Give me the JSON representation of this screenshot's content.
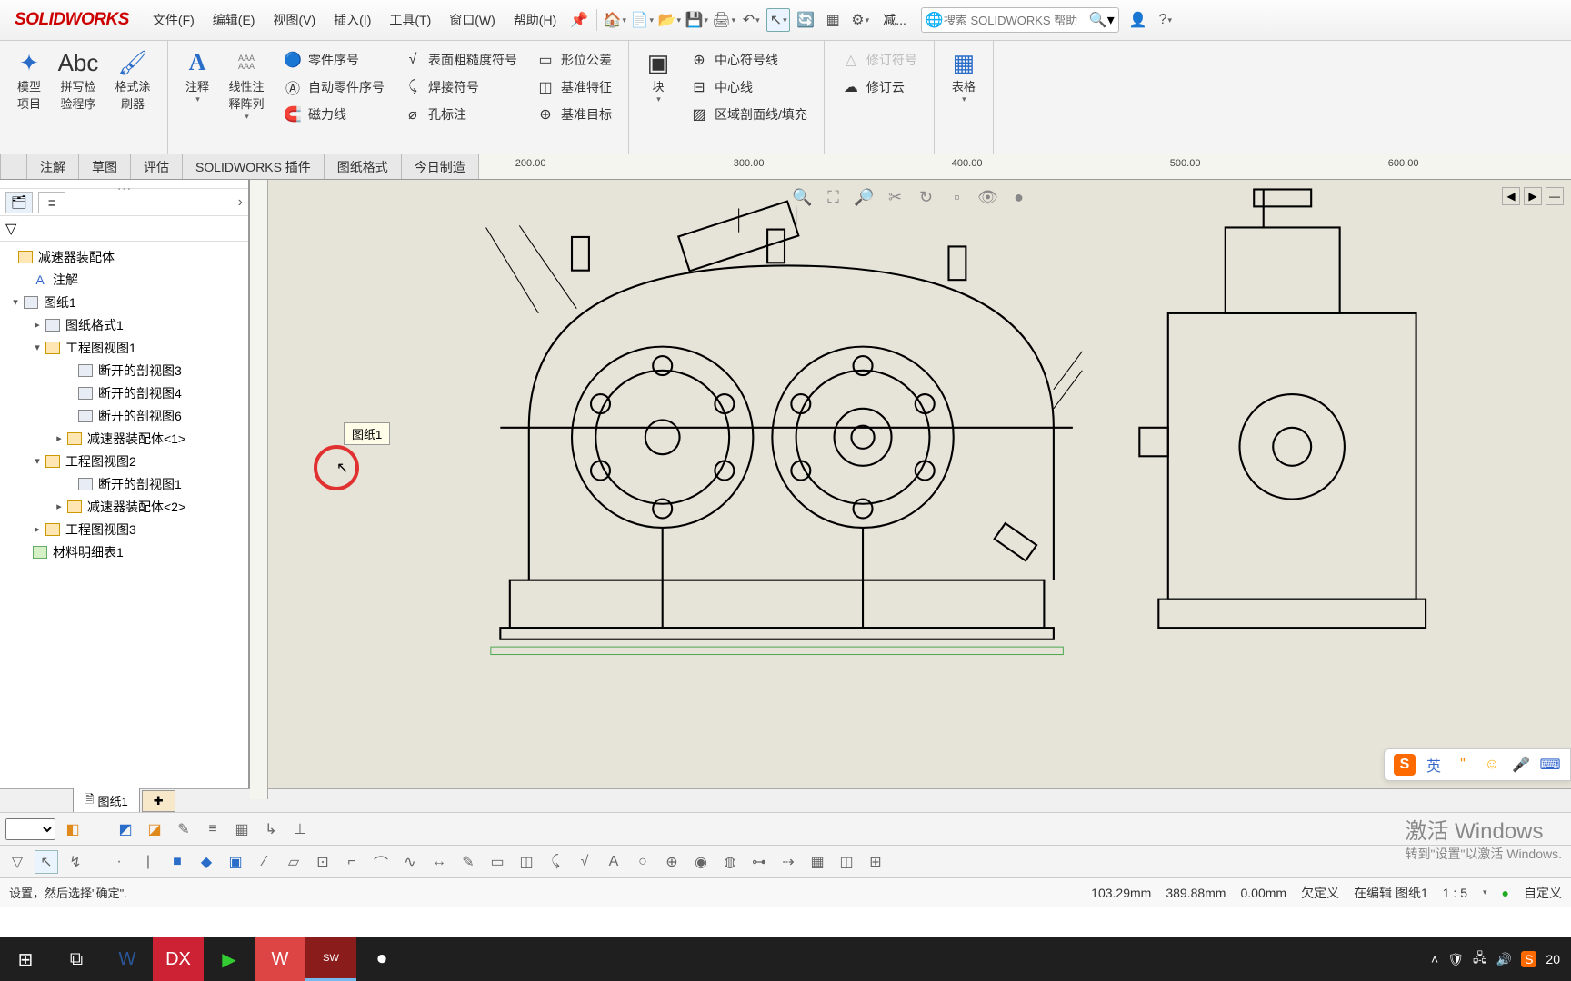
{
  "app": {
    "logo_text": "SOLIDWORKS"
  },
  "menu": {
    "file": "文件(F)",
    "edit": "编辑(E)",
    "view": "视图(V)",
    "insert": "插入(I)",
    "tools": "工具(T)",
    "window": "窗口(W)",
    "help": "帮助(H)"
  },
  "topbar": {
    "search_placeholder": "搜索 SOLIDWORKS 帮助",
    "truncated": "减..."
  },
  "ribbon": {
    "model_item": "模型项目",
    "spell": "拼写检验程序",
    "format": "格式涂刷器",
    "annotation": "注释",
    "linear_note": "线性注释阵列",
    "col1": {
      "a": "零件序号",
      "b": "自动零件序号",
      "c": "磁力线"
    },
    "col2": {
      "a": "表面粗糙度符号",
      "b": "焊接符号",
      "c": "孔标注"
    },
    "col3": {
      "a": "形位公差",
      "b": "基准特征",
      "c": "基准目标"
    },
    "block": "块",
    "col4": {
      "a": "中心符号线",
      "b": "中心线",
      "c": "区域剖面线/填充"
    },
    "rev_symbol": "修订符号",
    "rev_cloud": "修订云",
    "table": "表格"
  },
  "tabs": {
    "t1": "",
    "t2": "注解",
    "t3": "草图",
    "t4": "评估",
    "t5": "SOLIDWORKS 插件",
    "t6": "图纸格式",
    "t7": "今日制造"
  },
  "ruler": {
    "r1": "200.00",
    "r2": "300.00",
    "r3": "400.00",
    "r4": "500.00",
    "r5": "600.00"
  },
  "tree": {
    "root": "减速器装配体",
    "annotations": "注解",
    "sheet1": "图纸1",
    "sheet_format1": "图纸格式1",
    "view1": "工程图视图1",
    "sec3": "断开的剖视图3",
    "sec4": "断开的剖视图4",
    "sec6": "断开的剖视图6",
    "asm1": "减速器装配体<1>",
    "view2": "工程图视图2",
    "sec1": "断开的剖视图1",
    "asm2": "减速器装配体<2>",
    "view3": "工程图视图3",
    "bom": "材料明细表1"
  },
  "canvas": {
    "tooltip": "图纸1"
  },
  "sheet_tab": "图纸1",
  "status": {
    "left": "设置，然后选择\"确定\".",
    "x": "103.29mm",
    "y": "389.88mm",
    "z": "0.00mm",
    "def": "欠定义",
    "editing": "在编辑 图纸1",
    "scale": "1 : 5",
    "custom": "自定义"
  },
  "watermark": {
    "t1": "激活 Windows",
    "t2": "转到\"设置\"以激活 Windows."
  },
  "ime": {
    "lang": "英"
  },
  "tray": {
    "time": "20"
  }
}
